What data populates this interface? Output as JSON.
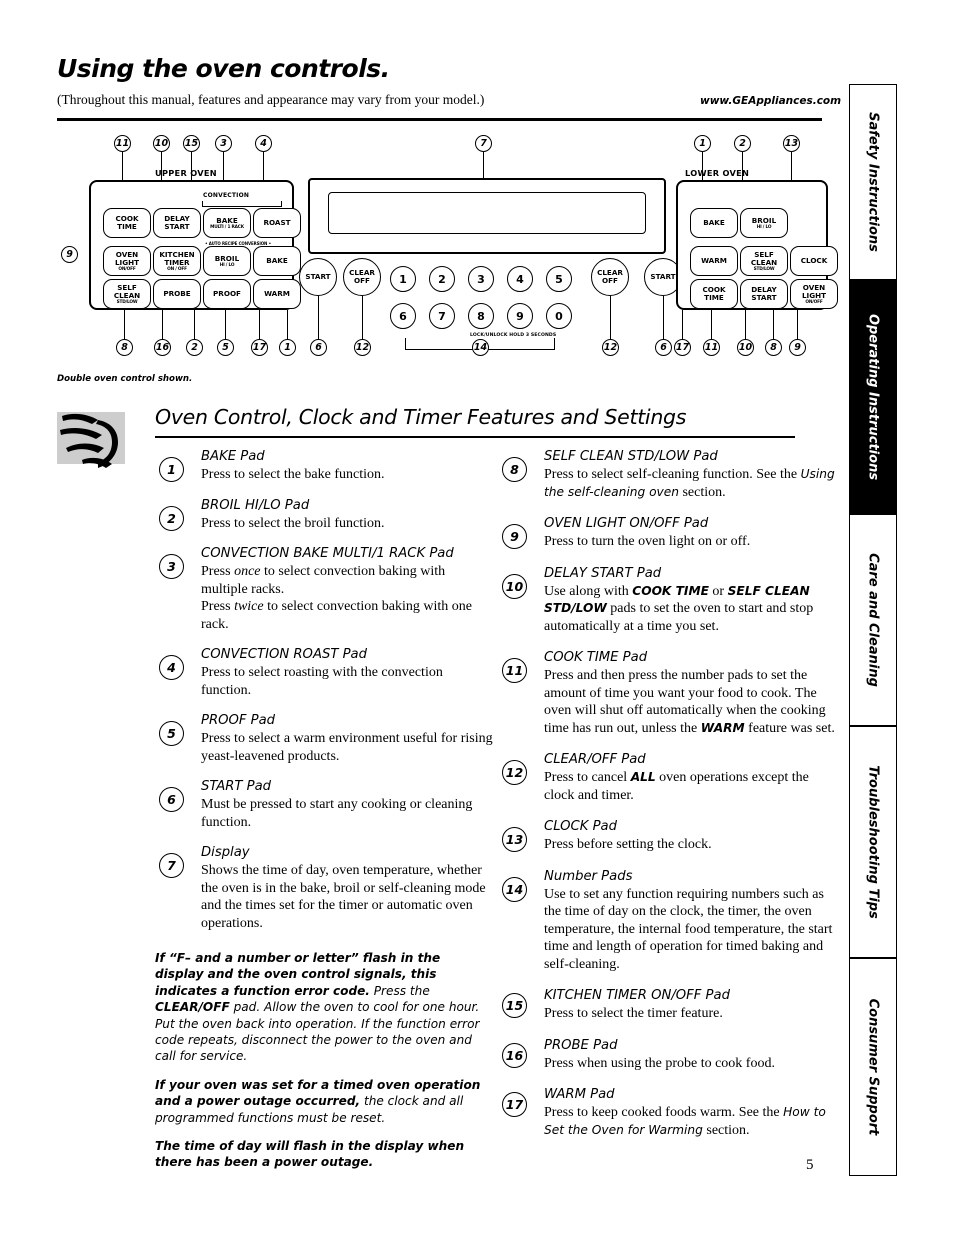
{
  "header": {
    "title": "Using the oven controls.",
    "subtitle": "(Throughout this manual, features and appearance may vary from your model.)",
    "url": "www.GEAppliances.com"
  },
  "side_tabs": [
    {
      "label": "Safety Instructions",
      "active": false
    },
    {
      "label": "Operating Instructions",
      "active": true
    },
    {
      "label": "Care and Cleaning",
      "active": false
    },
    {
      "label": "Troubleshooting Tips",
      "active": false
    },
    {
      "label": "Consumer Support",
      "active": false
    }
  ],
  "diagram": {
    "upper_oven_label": "UPPER OVEN",
    "lower_oven_label": "LOWER OVEN",
    "convection_label": "CONVECTION",
    "auto_recipe_label": "• AUTO RECIPE CONVERSION •",
    "lock_label": "LOCK/UNLOCK HOLD 3 SECONDS",
    "caption": "Double oven control shown.",
    "upper_pads": [
      {
        "l1": "COOK",
        "l2": "TIME",
        "sub": ""
      },
      {
        "l1": "DELAY",
        "l2": "START",
        "sub": ""
      },
      {
        "l1": "BAKE",
        "l2": "",
        "sub": "MULTI / 1 RACK"
      },
      {
        "l1": "ROAST",
        "l2": "",
        "sub": ""
      },
      {
        "l1": "OVEN",
        "l2": "LIGHT",
        "sub": "ON/OFF"
      },
      {
        "l1": "KITCHEN",
        "l2": "TIMER",
        "sub": "ON / OFF"
      },
      {
        "l1": "BROIL",
        "l2": "",
        "sub": "HI / LO"
      },
      {
        "l1": "BAKE",
        "l2": "",
        "sub": ""
      },
      {
        "l1": "SELF",
        "l2": "CLEAN",
        "sub": "STD/LOW"
      },
      {
        "l1": "PROBE",
        "l2": "",
        "sub": ""
      },
      {
        "l1": "PROOF",
        "l2": "",
        "sub": ""
      },
      {
        "l1": "WARM",
        "l2": "",
        "sub": ""
      }
    ],
    "round_pads": [
      {
        "label": "START"
      },
      {
        "l1": "CLEAR",
        "l2": "OFF"
      },
      {
        "l1": "CLEAR",
        "l2": "OFF"
      },
      {
        "label": "START"
      }
    ],
    "lower_pads": [
      {
        "l1": "BAKE",
        "l2": "",
        "sub": ""
      },
      {
        "l1": "BROIL",
        "l2": "",
        "sub": "HI / LO"
      },
      {
        "l1": "WARM",
        "l2": "",
        "sub": ""
      },
      {
        "l1": "SELF",
        "l2": "CLEAN",
        "sub": "STD/LOW"
      },
      {
        "l1": "CLOCK",
        "l2": "",
        "sub": ""
      },
      {
        "l1": "COOK",
        "l2": "TIME",
        "sub": ""
      },
      {
        "l1": "DELAY",
        "l2": "START",
        "sub": ""
      },
      {
        "l1": "OVEN",
        "l2": "LIGHT",
        "sub": "ON/OFF"
      }
    ],
    "number_pads": [
      "1",
      "2",
      "3",
      "4",
      "5",
      "6",
      "7",
      "8",
      "9",
      "0"
    ],
    "callouts_top": [
      "11",
      "10",
      "15",
      "3",
      "4",
      "7",
      "1",
      "2",
      "13"
    ],
    "callouts_bottom": [
      "8",
      "16",
      "2",
      "5",
      "17",
      "1",
      "6",
      "12",
      "14",
      "12",
      "6",
      "17",
      "11",
      "10",
      "8",
      "9"
    ],
    "callout_left": "9"
  },
  "section": {
    "heading": "Oven Control, Clock and Timer Features and Settings"
  },
  "features_left": [
    {
      "num": "1",
      "title": "BAKE Pad",
      "text": "Press to select the bake function."
    },
    {
      "num": "2",
      "title": "BROIL HI/LO Pad",
      "text": "Press to select the broil function."
    },
    {
      "num": "3",
      "title": "CONVECTION BAKE MULTI/1 RACK Pad",
      "text": "Press once to select convection baking with multiple racks.\nPress twice to select convection baking with one rack."
    },
    {
      "num": "4",
      "title": "CONVECTION ROAST Pad",
      "text": "Press to select roasting with the convection function."
    },
    {
      "num": "5",
      "title": "PROOF Pad",
      "text": "Press to select a warm environment useful for rising yeast-leavened products."
    },
    {
      "num": "6",
      "title": "START Pad",
      "text": "Must be pressed to start any cooking or cleaning function."
    },
    {
      "num": "7",
      "title": "Display",
      "text": "Shows the time of day, oven temperature, whether the oven is in the bake, broil or self-cleaning mode and the times set for the timer or automatic oven operations."
    }
  ],
  "notes": [
    "If “F– and a number or letter” flash in the display and the oven control signals, this indicates a function error code. Press the CLEAR/OFF pad. Allow the oven to cool for one hour. Put the oven back into operation. If the function error code repeats, disconnect the power to the oven and call for service.",
    "If your oven was set for a timed oven operation and a power outage occurred, the clock and all programmed functions must be reset.",
    "The time of day will flash in the display when there has been a power outage."
  ],
  "features_right": [
    {
      "num": "8",
      "title": "SELF CLEAN STD/LOW Pad",
      "text": "Press to select self-cleaning function. See the Using the self-cleaning oven section."
    },
    {
      "num": "9",
      "title": "OVEN LIGHT ON/OFF Pad",
      "text": "Press to turn the oven light on or off."
    },
    {
      "num": "10",
      "title": "DELAY START Pad",
      "text": "Use along with COOK TIME or SELF CLEAN STD/LOW pads to set the oven to start and stop automatically at a time you set."
    },
    {
      "num": "11",
      "title": "COOK TIME Pad",
      "text": "Press and then press the number pads to set the amount of time you want your food to cook. The oven will shut off automatically when the cooking time has run out, unless the WARM feature was set."
    },
    {
      "num": "12",
      "title": "CLEAR/OFF Pad",
      "text": "Press to cancel ALL oven operations except the clock and timer."
    },
    {
      "num": "13",
      "title": "CLOCK Pad",
      "text": "Press before setting the clock."
    },
    {
      "num": "14",
      "title": "Number Pads",
      "text": "Use to set any function requiring numbers such as the time of day on the clock, the timer, the oven temperature, the internal food temperature, the start time and length of operation for timed baking and self-cleaning."
    },
    {
      "num": "15",
      "title": "KITCHEN TIMER ON/OFF Pad",
      "text": "Press to select the timer feature."
    },
    {
      "num": "16",
      "title": "PROBE Pad",
      "text": "Press when using the probe to cook food."
    },
    {
      "num": "17",
      "title": "WARM Pad",
      "text": "Press to keep cooked foods warm. See the How to Set the Oven for Warming section."
    }
  ],
  "page_number": "5"
}
